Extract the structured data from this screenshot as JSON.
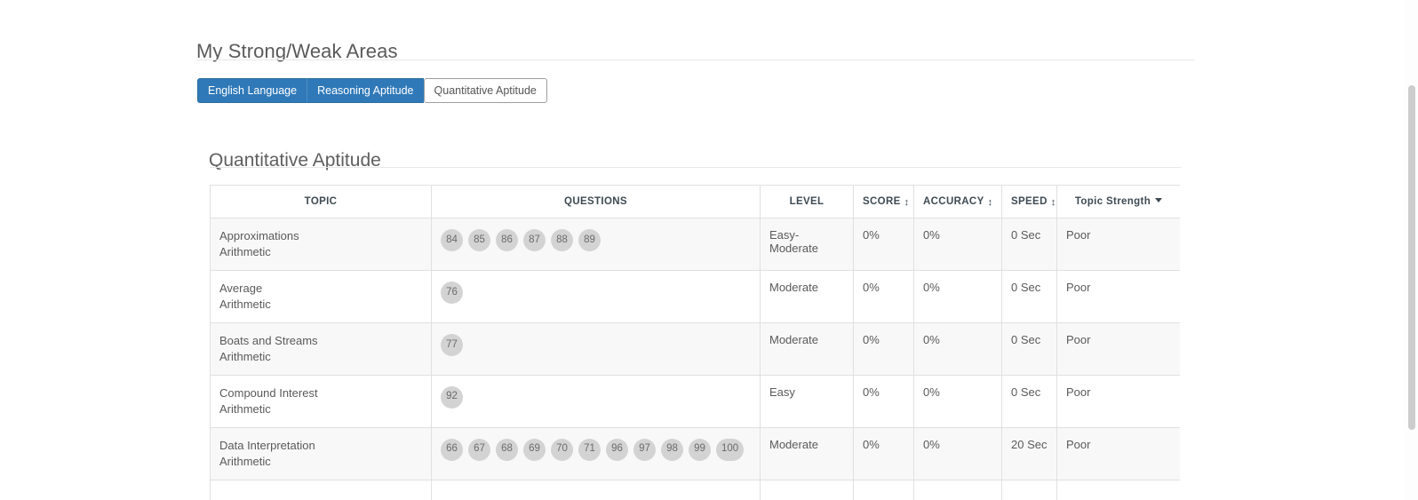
{
  "page": {
    "title": "My Strong/Weak Areas",
    "section_title": "Quantitative Aptitude"
  },
  "tabs": [
    {
      "label": "English Language",
      "selected": false
    },
    {
      "label": "Reasoning Aptitude",
      "selected": false
    },
    {
      "label": "Quantitative Aptitude",
      "selected": true
    }
  ],
  "table": {
    "headers": {
      "topic": "TOPIC",
      "questions": "QUESTIONS",
      "level": "LEVEL",
      "score": "SCORE",
      "accuracy": "ACCURACY",
      "speed": "SPEED",
      "strength": "Topic Strength"
    },
    "header_icons": {
      "sort": "sort-icon",
      "caret": "chevron-down-icon"
    },
    "rows": [
      {
        "topic": "Approximations",
        "category": "Arithmetic",
        "questions": [
          "84",
          "85",
          "86",
          "87",
          "88",
          "89"
        ],
        "level": "Easy-Moderate",
        "score": "0%",
        "accuracy": "0%",
        "speed": "0 Sec",
        "strength": "Poor"
      },
      {
        "topic": "Average",
        "category": "Arithmetic",
        "questions": [
          "76"
        ],
        "level": "Moderate",
        "score": "0%",
        "accuracy": "0%",
        "speed": "0 Sec",
        "strength": "Poor"
      },
      {
        "topic": "Boats and Streams",
        "category": "Arithmetic",
        "questions": [
          "77"
        ],
        "level": "Moderate",
        "score": "0%",
        "accuracy": "0%",
        "speed": "0 Sec",
        "strength": "Poor"
      },
      {
        "topic": "Compound Interest",
        "category": "Arithmetic",
        "questions": [
          "92"
        ],
        "level": "Easy",
        "score": "0%",
        "accuracy": "0%",
        "speed": "0 Sec",
        "strength": "Poor"
      },
      {
        "topic": "Data Interpretation",
        "category": "Arithmetic",
        "questions": [
          "66",
          "67",
          "68",
          "69",
          "70",
          "71",
          "96",
          "97",
          "98",
          "99",
          "100"
        ],
        "level": "Moderate",
        "score": "0%",
        "accuracy": "0%",
        "speed": "20 Sec",
        "strength": "Poor"
      },
      {
        "topic": "",
        "category": "",
        "questions": [
          ""
        ],
        "level": "",
        "score": "",
        "accuracy": "",
        "speed": "",
        "strength": ""
      }
    ]
  },
  "colors": {
    "tab_active_blue": "#3079b8",
    "bar_negative": "#c9595b",
    "bar_positive": "#27a22a",
    "badge_bg": "#d3d3d3",
    "text": "#5a5a5a"
  }
}
